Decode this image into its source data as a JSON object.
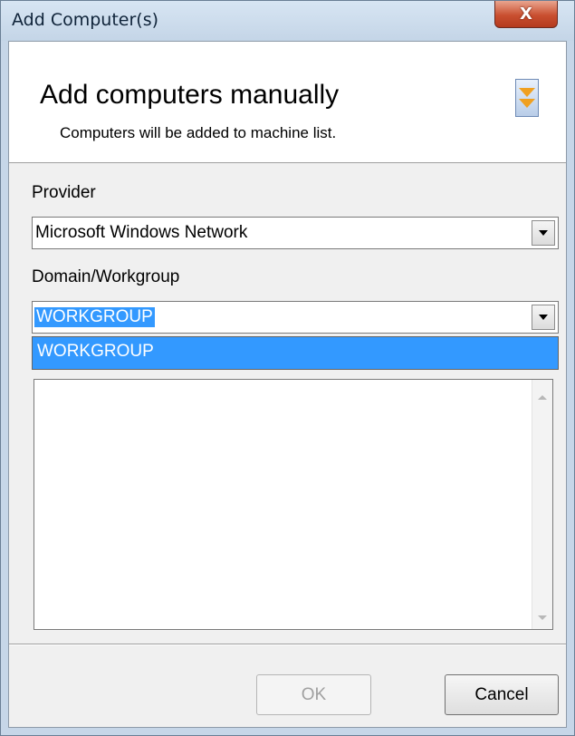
{
  "window": {
    "title": "Add Computer(s)",
    "close_glyph": "X"
  },
  "header": {
    "title": "Add computers manually",
    "subtitle": "Computers will be added to machine list.",
    "collapse_icon": "double-chevron-down-icon"
  },
  "provider": {
    "label": "Provider",
    "value": "Microsoft Windows Network"
  },
  "domain": {
    "label": "Domain/Workgroup",
    "value": "WORKGROUP",
    "dropdown_options": [
      "WORKGROUP"
    ],
    "highlighted_option": "WORKGROUP"
  },
  "computers_list": {
    "items": []
  },
  "buttons": {
    "ok_label": "OK",
    "cancel_label": "Cancel"
  },
  "colors": {
    "selection": "#3399ff",
    "close_button": "#c94f30",
    "collapse_arrow": "#f0a020"
  }
}
